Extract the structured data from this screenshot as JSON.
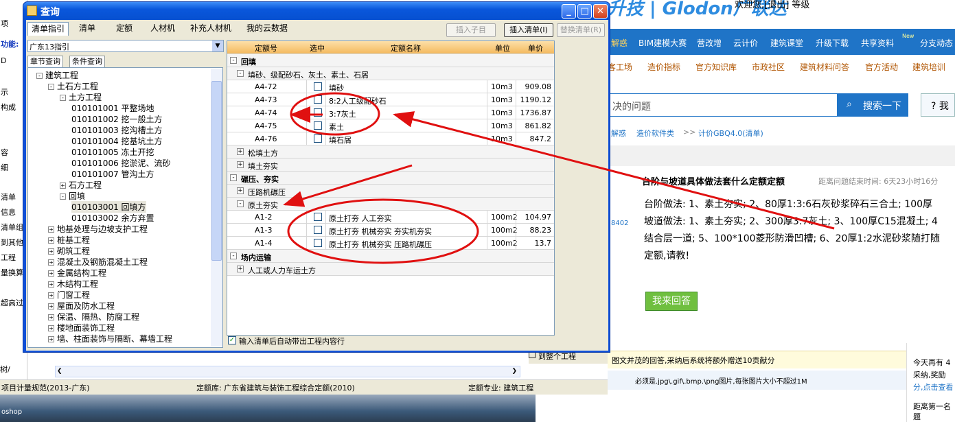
{
  "background": {
    "left_items": [
      "项",
      "功能:",
      "D",
      "示",
      "构成",
      "容",
      "细",
      "清单",
      "信息",
      "清单组",
      "到其他",
      "工程",
      "量换算",
      "超高过"
    ],
    "tree_tab": "树/",
    "embedded_text": "到整个工程",
    "taskbar_text": "oshop"
  },
  "status_bar": {
    "spec": "项目计量规范(2013-广东)",
    "quota_lib": "定额库: 广东省建筑与装饰工程综合定额(2010)",
    "quota_major": "定额专业: 建筑工程"
  },
  "web": {
    "logo": "升技 | Glodon广联达",
    "welcome": "欢迎您,[退出]   等级",
    "nav": [
      "解惑",
      "BIM建模大赛",
      "营改增",
      "云计价",
      "建筑课堂",
      "升级下载",
      "共享资料",
      "分支动态"
    ],
    "nav_badge": "New",
    "subnav": [
      "客工场",
      "造价指标",
      "官方知识库",
      "市政社区",
      "建筑材料问答",
      "官方活动",
      "建筑培训"
    ],
    "search_placeholder": "决的问题",
    "search_button": "搜索一下",
    "help_button": "? 我",
    "breadcrumb": [
      "解惑",
      "造价软件类",
      ">>",
      "计价GBQ4.0(清单)"
    ],
    "question_title": "台阶与坡道具体做法套什么定额定额",
    "timer": "距离问题结束时间: 6天23小时16分",
    "user_id": "8402",
    "question_lines": [
      "台阶做法: 1、素土夯实; 2、80厚1:3:6石灰砂浆碎石三合土; 100厚",
      "坡道做法: 1、素土夯实; 2、300厚3:7灰土; 3、100厚C15混凝土; 4",
      "结合层一道; 5、100*100菱形防滑凹槽; 6、20厚1:2水泥砂浆随打随",
      "定额,请教!"
    ],
    "answer_button": "我来回答",
    "tip1": "图文并茂的回答,采纳后系统将额外赠送10贡献分",
    "tip2": "必须是.jpg\\.gif\\.bmp.\\png图片,每张图片大小不超过1M",
    "side": [
      "今天再有 4",
      "采纳,奖励",
      "分,点击查看",
      "距离第一名",
      "题"
    ]
  },
  "dialog": {
    "title": "查询",
    "tabs": [
      "清单指引",
      "清单",
      "定额",
      "人材机",
      "补充人材机",
      "我的云数据"
    ],
    "buttons": {
      "insert_child": "插入子目",
      "insert_list": "插入清单(I)",
      "replace_list": "替换清单(R)"
    },
    "combo": "广东13指引",
    "left_tabs": [
      "章节查询",
      "条件查询"
    ],
    "tree": [
      {
        "t": "建筑工程",
        "lvl": 0,
        "exp": "-"
      },
      {
        "t": "土石方工程",
        "lvl": 1,
        "exp": "-"
      },
      {
        "t": "土方工程",
        "lvl": 2,
        "exp": "-"
      },
      {
        "t": "010101001   平整场地",
        "lvl": 3
      },
      {
        "t": "010101002   挖一般土方",
        "lvl": 3
      },
      {
        "t": "010101003   挖沟槽土方",
        "lvl": 3
      },
      {
        "t": "010101004   挖基坑土方",
        "lvl": 3
      },
      {
        "t": "010101005   冻土开挖",
        "lvl": 3
      },
      {
        "t": "010101006   挖淤泥、流砂",
        "lvl": 3
      },
      {
        "t": "010101007   管沟土方",
        "lvl": 3
      },
      {
        "t": "石方工程",
        "lvl": 2,
        "exp": "+"
      },
      {
        "t": "回填",
        "lvl": 2,
        "exp": "-"
      },
      {
        "t": "010103001   回填方",
        "lvl": 3,
        "sel": true
      },
      {
        "t": "010103002   余方弃置",
        "lvl": 3
      },
      {
        "t": "地基处理与边坡支护工程",
        "lvl": 1,
        "exp": "+"
      },
      {
        "t": "桩基工程",
        "lvl": 1,
        "exp": "+"
      },
      {
        "t": "砌筑工程",
        "lvl": 1,
        "exp": "+"
      },
      {
        "t": "混凝土及钢筋混凝土工程",
        "lvl": 1,
        "exp": "+"
      },
      {
        "t": "金属结构工程",
        "lvl": 1,
        "exp": "+"
      },
      {
        "t": "木结构工程",
        "lvl": 1,
        "exp": "+"
      },
      {
        "t": "门窗工程",
        "lvl": 1,
        "exp": "+"
      },
      {
        "t": "屋面及防水工程",
        "lvl": 1,
        "exp": "+"
      },
      {
        "t": "保温、隔热、防腐工程",
        "lvl": 1,
        "exp": "+"
      },
      {
        "t": "楼地面装饰工程",
        "lvl": 1,
        "exp": "+"
      },
      {
        "t": "墙、柱面装饰与隔断、幕墙工程",
        "lvl": 1,
        "exp": "+"
      }
    ],
    "grid_headers": [
      "定额号",
      "选中",
      "定额名称",
      "单位",
      "单价"
    ],
    "grid_rows": [
      {
        "kind": "g1",
        "exp": "-",
        "name": "回填"
      },
      {
        "kind": "g2",
        "exp": "-",
        "name": "填砂、级配砂石、灰土、素土、石屑"
      },
      {
        "kind": "r",
        "code": "A4-72",
        "name": "填砂",
        "unit": "10m3",
        "price": "909.08"
      },
      {
        "kind": "r",
        "code": "A4-73",
        "name": "8:2人工级配砂石",
        "unit": "10m3",
        "price": "1190.12"
      },
      {
        "kind": "r",
        "code": "A4-74",
        "name": "3:7灰土",
        "unit": "10m3",
        "price": "1736.87"
      },
      {
        "kind": "r",
        "code": "A4-75",
        "name": "素土",
        "unit": "10m3",
        "price": "861.82"
      },
      {
        "kind": "r",
        "code": "A4-76",
        "name": "填石屑",
        "unit": "10m3",
        "price": "847.2"
      },
      {
        "kind": "g2",
        "exp": "+",
        "name": "松填土方"
      },
      {
        "kind": "g2",
        "exp": "+",
        "name": "填土夯实"
      },
      {
        "kind": "g1",
        "exp": "-",
        "name": "碾压、夯实"
      },
      {
        "kind": "g2",
        "exp": "+",
        "name": "压路机碾压"
      },
      {
        "kind": "g2",
        "exp": "-",
        "name": "原土夯实"
      },
      {
        "kind": "r",
        "code": "A1-2",
        "name": "原土打夯 人工夯实",
        "unit": "100m2",
        "price": "104.97"
      },
      {
        "kind": "r",
        "code": "A1-3",
        "name": "原土打夯 机械夯实 夯实机夯实",
        "unit": "100m2",
        "price": "88.23"
      },
      {
        "kind": "r",
        "code": "A1-4",
        "name": "原土打夯 机械夯实 压路机碾压",
        "unit": "100m2",
        "price": "13.7"
      },
      {
        "kind": "g1",
        "exp": "-",
        "name": "场内运输"
      },
      {
        "kind": "g2",
        "exp": "+",
        "name": "人工或人力车运土方"
      }
    ],
    "auto_option": "输入清单后自动带出工程内容行",
    "auto_checked": "✓"
  },
  "annotation_color": "#e01010"
}
